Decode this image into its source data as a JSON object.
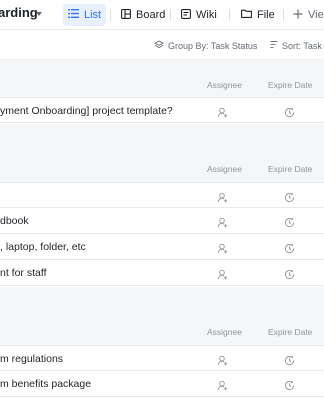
{
  "header": {
    "project_title": "arding",
    "tabs": [
      {
        "label": "List",
        "icon": "list-icon",
        "active": true
      },
      {
        "label": "Board",
        "icon": "board-icon",
        "active": false
      },
      {
        "label": "Wiki",
        "icon": "wiki-icon",
        "active": false
      },
      {
        "label": "File",
        "icon": "folder-icon",
        "active": false
      },
      {
        "label": "Vie",
        "icon": "plus-icon",
        "active": false
      }
    ]
  },
  "toolbar": {
    "group_by": "Group By: Task Status",
    "sort": "Sort: Task"
  },
  "columns": {
    "assignee": "Assignee",
    "expire_date": "Expire Date"
  },
  "groups": [
    {
      "tasks": [
        "yment Onboarding] project template?"
      ]
    },
    {
      "tasks": [
        "",
        "dbook",
        ", laptop, folder, etc",
        "nt for staff"
      ]
    },
    {
      "tasks": [
        "m regulations",
        "m benefits package"
      ]
    }
  ],
  "colors": {
    "accent": "#3370ff",
    "accent_bg": "#e8efff",
    "text": "#1f2329",
    "muted": "#8f959e",
    "band": "#f5f6f7"
  }
}
